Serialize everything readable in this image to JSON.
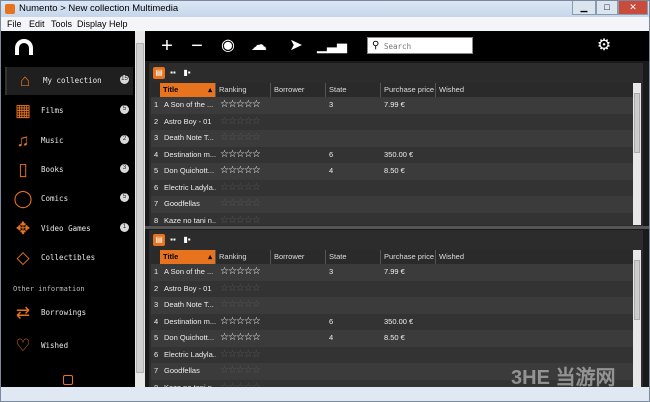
{
  "window": {
    "title": "Numento > New collection Multimedia",
    "controls": [
      "minimize",
      "maximize",
      "close"
    ]
  },
  "menu": [
    "File",
    "Edit",
    "Tools",
    "Display",
    "Help"
  ],
  "sidebar": {
    "items": [
      {
        "label": "My collection",
        "count": "15",
        "icon": "house-icon"
      },
      {
        "label": "Films",
        "count": "5",
        "icon": "film-icon"
      },
      {
        "label": "Music",
        "count": "2",
        "icon": "headphones-icon"
      },
      {
        "label": "Books",
        "count": "3",
        "icon": "book-icon"
      },
      {
        "label": "Comics",
        "count": "5",
        "icon": "speech-bubble-icon"
      },
      {
        "label": "Video Games",
        "count": "1",
        "icon": "gamepad-icon"
      },
      {
        "label": "Collectibles",
        "count": "",
        "icon": "diamond-icon"
      }
    ],
    "section_label": "Other information",
    "extra_items": [
      {
        "label": "Borrowings",
        "icon": "swap-icon"
      },
      {
        "label": "Wished",
        "icon": "heart-icon"
      }
    ]
  },
  "toolbar": {
    "search_placeholder": "Search",
    "icons": [
      "add-icon",
      "remove-icon",
      "view-icon",
      "download-icon",
      "send-icon",
      "stats-icon",
      "settings-icon"
    ]
  },
  "table": {
    "columns": [
      "Title",
      "Ranking",
      "Borrower",
      "State",
      "Purchase price",
      "Wished"
    ],
    "sorted_column": "Title",
    "rows": [
      {
        "num": "1",
        "title": "A Son of the ...",
        "rated": true,
        "state": "3",
        "price": "7.99 €"
      },
      {
        "num": "2",
        "title": "Astro Boy - 01",
        "rated": false,
        "state": "",
        "price": ""
      },
      {
        "num": "3",
        "title": "Death Note T...",
        "rated": false,
        "state": "",
        "price": ""
      },
      {
        "num": "4",
        "title": "Destination m...",
        "rated": true,
        "state": "6",
        "price": "350.00 €"
      },
      {
        "num": "5",
        "title": "Don Quichott...",
        "rated": true,
        "state": "4",
        "price": "8.50 €"
      },
      {
        "num": "6",
        "title": "Electric Ladyla...",
        "rated": false,
        "state": "",
        "price": ""
      },
      {
        "num": "7",
        "title": "Goodfellas",
        "rated": false,
        "state": "",
        "price": ""
      },
      {
        "num": "8",
        "title": "Kaze no tani n...",
        "rated": false,
        "state": "",
        "price": ""
      }
    ]
  },
  "watermark": "3HE 当游网"
}
